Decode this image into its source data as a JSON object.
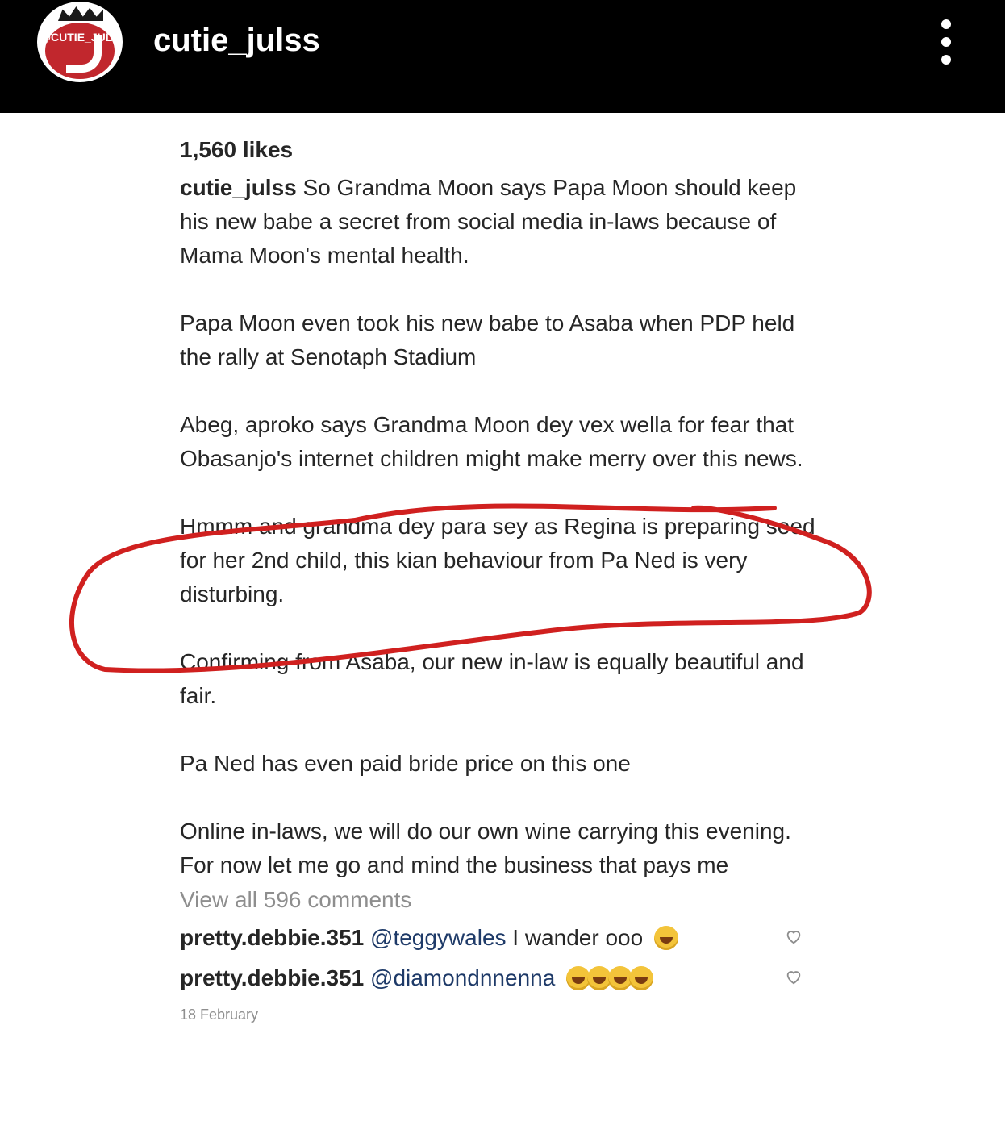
{
  "header": {
    "avatar_text": "@CUTIE_JULS",
    "username": "cutie_julss"
  },
  "post": {
    "likes": "1,560 likes",
    "caption_user": "cutie_julss",
    "caption_first": " So Grandma Moon says Papa Moon should keep his new babe a secret from social media in-laws because of Mama Moon's mental health.",
    "paragraphs": [
      "Papa Moon even took his new babe to  Asaba when PDP held the rally at Senotaph Stadium",
      "Abeg, aproko says Grandma Moon dey vex wella for fear that Obasanjo's internet children might make merry over this news.",
      "Hmmm and grandma dey para sey as Regina is preparing seed for her 2nd child, this kian behaviour from Pa Ned is very disturbing.",
      "Confirming from Asaba, our new in-law is equally beautiful and fair.",
      "Pa Ned has even paid bride price on this one",
      "Online in-laws, we will do our own wine carrying this evening. For now let me go and mind the business that pays me"
    ],
    "view_all_comments": "View all 596 comments",
    "comments": [
      {
        "user": "pretty.debbie.351",
        "mention": "@teggywales",
        "text": " I wander ooo",
        "emoji_count": 1
      },
      {
        "user": "pretty.debbie.351",
        "mention": "@diamondnnenna",
        "text": "",
        "emoji_count": 4
      }
    ],
    "date": "18 February"
  },
  "colors": {
    "highlight_circle": "#d0201f",
    "mention": "#1e3a68",
    "muted": "#8e8e8e"
  },
  "icons": [
    "more-options-icon",
    "heart-icon",
    "laughing-emoji-icon"
  ]
}
